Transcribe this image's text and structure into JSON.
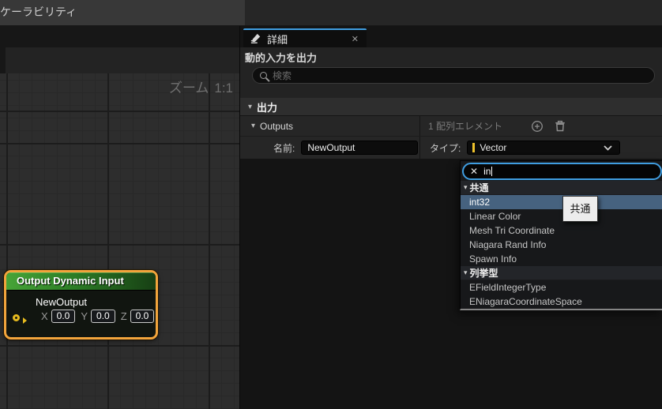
{
  "window": {
    "top_tab_label": "ケーラビリティ"
  },
  "graph": {
    "zoom_label": "ズーム",
    "zoom_value": "1:1",
    "node": {
      "title": "Output Dynamic Input",
      "pin_label": "NewOutput",
      "fields": [
        {
          "label": "X",
          "value": "0.0"
        },
        {
          "label": "Y",
          "value": "0.0"
        },
        {
          "label": "Z",
          "value": "0.0"
        }
      ]
    }
  },
  "details": {
    "tab_title": "詳細",
    "subtitle": "動的入力を出力",
    "search_placeholder": "検索",
    "section_output_label": "出力",
    "outputs_row": {
      "label": "Outputs",
      "count_label": "1 配列エレメント"
    },
    "name_field": {
      "label": "名前:",
      "value": "NewOutput"
    },
    "type_field": {
      "label": "タイプ:",
      "value": "Vector"
    }
  },
  "type_picker": {
    "search_value": "in",
    "tooltip": "共通",
    "groups": [
      {
        "label": "共通",
        "items": [
          "int32",
          "Linear Color",
          "Mesh Tri Coordinate",
          "Niagara Rand Info",
          "Spawn Info"
        ]
      },
      {
        "label": "列挙型",
        "items": [
          "EFieldIntegerType",
          "ENiagaraCoordinateSpace"
        ]
      }
    ],
    "selected_item": "int32"
  },
  "icons": {
    "collapse": "▾",
    "close": "✕",
    "clear": "✕"
  },
  "colors": {
    "accent_blue": "#3f9de0",
    "selection_orange": "#f2a43c",
    "node_header_green": "#2c7d26",
    "type_vector_yellow": "#eec22c",
    "highlight_slate": "#46627f",
    "grid_bg": "#2d2d2d"
  }
}
